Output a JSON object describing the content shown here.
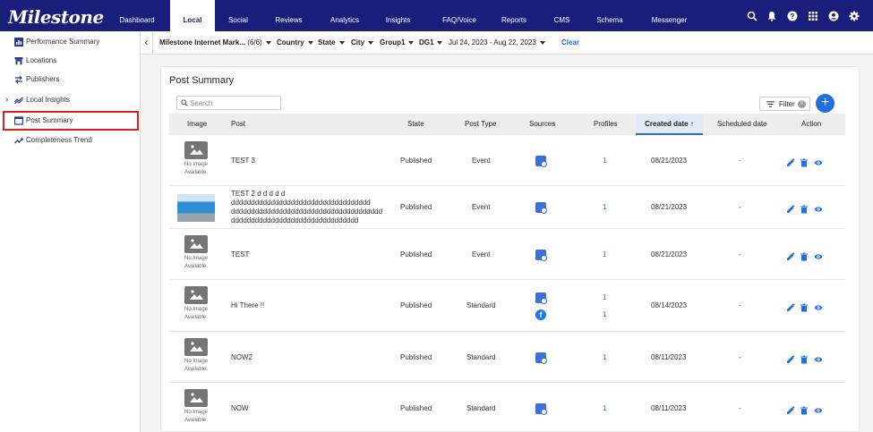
{
  "brand": {
    "logo": "Milestone",
    "nav_color": "#1a1d7a",
    "accent": "#1e6fe0"
  },
  "nav": {
    "items": [
      "Dashboard",
      "Local",
      "Social",
      "Reviews",
      "Analytics",
      "Insights",
      "FAQ/Voice",
      "Reports",
      "CMS",
      "Schema",
      "Messenger"
    ],
    "active": "Local",
    "icons": [
      "search-icon",
      "bell-icon",
      "help-icon",
      "apps-grid-icon",
      "account-icon",
      "settings-icon"
    ]
  },
  "sidebar": {
    "items": [
      {
        "label": "Performance Summary",
        "icon": "bar-chart-icon"
      },
      {
        "label": "Locations",
        "icon": "store-icon"
      },
      {
        "label": "Publishers",
        "icon": "swap-arrows-icon"
      },
      {
        "label": "Local Insights",
        "icon": "trend-icon"
      },
      {
        "label": "Post Summary",
        "icon": "window-icon"
      },
      {
        "label": "Completeness Trend",
        "icon": "trend-up-icon"
      }
    ],
    "selected": "Post Summary"
  },
  "filters": {
    "account": "Milestone Internet Mark...",
    "account_count": "(6/6)",
    "country": "Country",
    "state": "State",
    "city": "City",
    "group1": "Group1",
    "dg1": "DG1",
    "date_range": "Jul 24, 2023 - Aug 22, 2023",
    "clear": "Clear"
  },
  "panel": {
    "title": "Post Summary",
    "search_placeholder": "Search",
    "filter_label": "Filter",
    "filter_count": "0",
    "add_label": "+"
  },
  "table": {
    "columns": [
      "Image",
      "Post",
      "State",
      "Post Type",
      "Sources",
      "Profiles",
      "Created date ↑",
      "Scheduled date",
      "Action"
    ],
    "no_image_line1": "No Image",
    "no_image_line2": "Available.",
    "rows": [
      {
        "image": "none",
        "post": [
          "TEST 3"
        ],
        "state": "Published",
        "type": "Event",
        "sources": [
          "google-business-icon"
        ],
        "profiles": [
          "1"
        ],
        "created": "08/21/2023",
        "scheduled": "-"
      },
      {
        "image": "photo",
        "post": [
          "TEST 2 d d d d d",
          "ddddddddddddddddddddddddddddddddddd",
          "dddddddddddddddddddddddddddddddddddddd",
          "dddddddddddddddddddddddddddddddd"
        ],
        "state": "Published",
        "type": "Event",
        "sources": [
          "google-business-icon"
        ],
        "profiles": [
          "1"
        ],
        "created": "08/21/2023",
        "scheduled": "-"
      },
      {
        "image": "none",
        "post": [
          "TEST"
        ],
        "state": "Published",
        "type": "Event",
        "sources": [
          "google-business-icon"
        ],
        "profiles": [
          "1"
        ],
        "created": "08/21/2023",
        "scheduled": "-"
      },
      {
        "image": "none",
        "post": [
          "Hi There !!"
        ],
        "state": "Published",
        "type": "Standard",
        "sources": [
          "google-business-icon",
          "facebook-icon"
        ],
        "profiles": [
          "1",
          "1"
        ],
        "created": "08/14/2023",
        "scheduled": "-"
      },
      {
        "image": "none",
        "post": [
          "NOW2"
        ],
        "state": "Published",
        "type": "Standard",
        "sources": [
          "google-business-icon"
        ],
        "profiles": [
          "1"
        ],
        "created": "08/11/2023",
        "scheduled": "-"
      },
      {
        "image": "none",
        "post": [
          "NOW"
        ],
        "state": "Published",
        "type": "Standard",
        "sources": [
          "google-business-icon"
        ],
        "profiles": [
          "1"
        ],
        "created": "08/11/2023",
        "scheduled": "-"
      }
    ]
  }
}
